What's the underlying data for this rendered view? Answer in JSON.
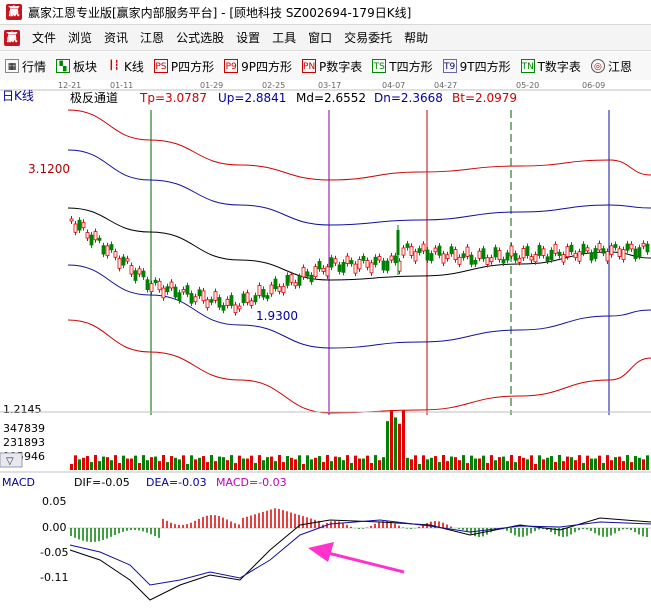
{
  "window": {
    "title": "赢家江恩专业版[赢家内部服务平台] - [顾地科技  SZ002694-179日K线]"
  },
  "menu": {
    "items": [
      "文件",
      "浏览",
      "资讯",
      "江恩",
      "公式选股",
      "设置",
      "工具",
      "窗口",
      "交易委托",
      "帮助"
    ]
  },
  "toolbar": {
    "items": [
      {
        "label": "行情",
        "icon": "grid-icon"
      },
      {
        "label": "板块",
        "icon": "blocks-icon"
      },
      {
        "label": "K线",
        "icon": "kline-icon"
      },
      {
        "label": "P四方形",
        "icon": "PS"
      },
      {
        "label": "9P四方形",
        "icon": "P9"
      },
      {
        "label": "P数字表",
        "icon": "PN"
      },
      {
        "label": "T四方形",
        "icon": "TS"
      },
      {
        "label": "9T四方形",
        "icon": "T9"
      },
      {
        "label": "T数字表",
        "icon": "TN"
      },
      {
        "label": "江恩",
        "icon": "target-icon"
      }
    ]
  },
  "price_panel": {
    "period_label": "日K线",
    "indicator_name": "极反通道",
    "tp": "Tp=3.0787",
    "up": "Up=2.8841",
    "md": "Md=2.6552",
    "dn": "Dn=2.3668",
    "bt": "Bt=2.0979",
    "price_high": "3.1200",
    "price_low_axis": "1.2145",
    "low_marker": "1.9300",
    "date_ticks": [
      "12-21",
      "01-11",
      "01-29",
      "02-25",
      "03-17",
      "04-07",
      "04-27",
      "05-20",
      "06-09"
    ]
  },
  "volume_panel": {
    "ticks": [
      "347839",
      "231893",
      "115946"
    ]
  },
  "macd_panel": {
    "name": "MACD",
    "dif": "DIF=-0.05",
    "dea": "DEA=-0.03",
    "macd": "MACD=-0.03",
    "ticks": [
      "0.05",
      "0.00",
      "-0.05",
      "-0.11"
    ]
  },
  "colors": {
    "up": "#e00000",
    "down": "#008000",
    "band_outer": "#d00000",
    "band_inner": "#1010a0",
    "mid": "#000000",
    "arrow": "#ff33cc"
  }
}
